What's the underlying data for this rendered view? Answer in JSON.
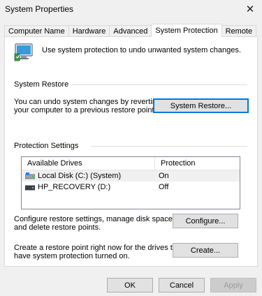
{
  "window": {
    "title": "System Properties"
  },
  "tabs": [
    {
      "label": "Computer Name"
    },
    {
      "label": "Hardware"
    },
    {
      "label": "Advanced"
    },
    {
      "label": "System Protection"
    },
    {
      "label": "Remote"
    }
  ],
  "intro": "Use system protection to undo unwanted system changes.",
  "system_restore": {
    "group_label": "System Restore",
    "description": [
      "You can undo system changes by reverting",
      "your computer to a previous restore point."
    ],
    "button": "System Restore..."
  },
  "protection": {
    "group_label": "Protection Settings",
    "columns": [
      "Available Drives",
      "Protection"
    ],
    "drives": [
      {
        "name": "Local Disk (C:) (System)",
        "protection": "On",
        "icon": "system-drive-icon"
      },
      {
        "name": "HP_RECOVERY (D:)",
        "protection": "Off",
        "icon": "drive-icon"
      }
    ]
  },
  "configure": {
    "description": [
      "Configure restore settings, manage disk space,",
      "and delete restore points."
    ],
    "button": "Configure..."
  },
  "create": {
    "description": [
      "Create a restore point right now for the drives that",
      "have system protection turned on."
    ],
    "button": "Create..."
  },
  "footer": {
    "ok": "OK",
    "cancel": "Cancel",
    "apply": "Apply"
  }
}
